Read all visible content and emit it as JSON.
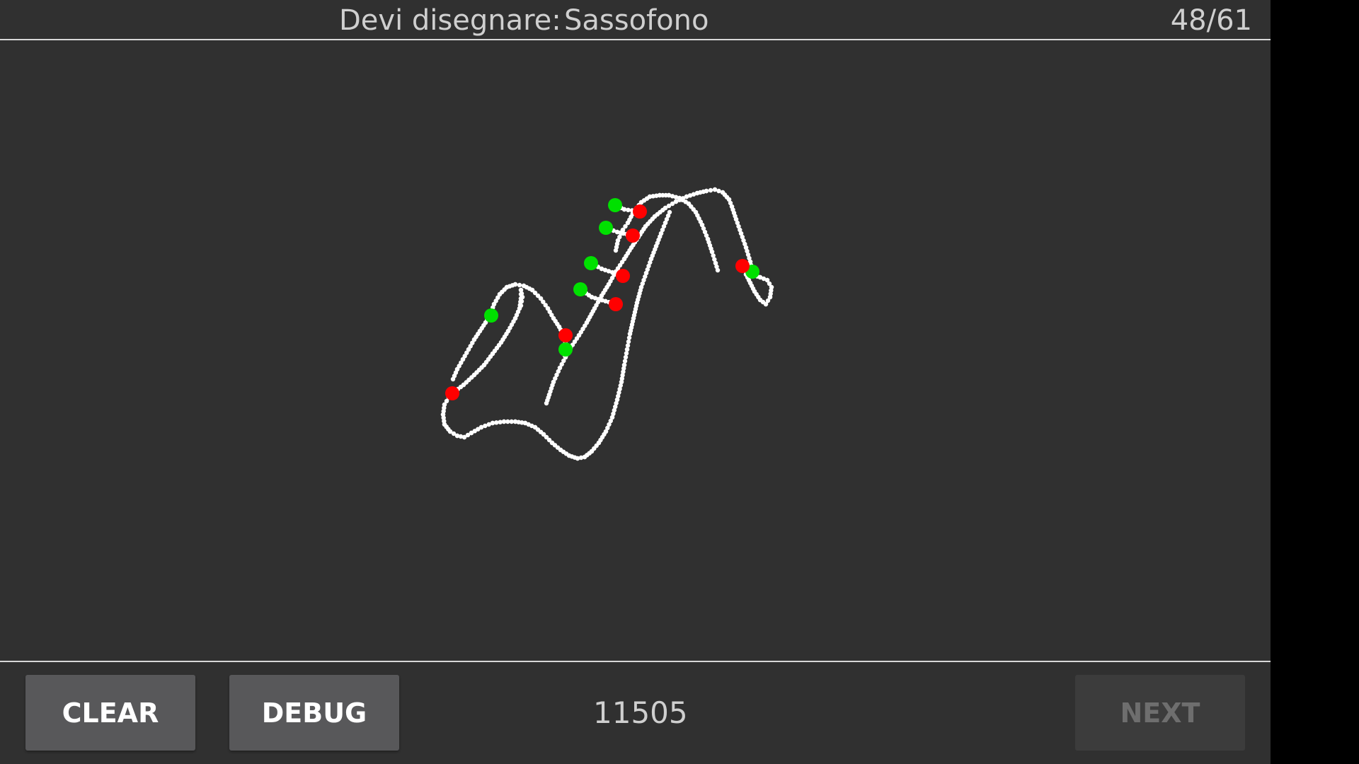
{
  "header": {
    "prompt_label": "Devi disegnare:",
    "prompt_word": "Sassofono",
    "progress": "48/61"
  },
  "footer": {
    "clear_label": "CLEAR",
    "debug_label": "DEBUG",
    "score": "11505",
    "next_label": "NEXT"
  },
  "colors": {
    "background": "#303030",
    "stroke": "#ffffff",
    "stroke_start": "#00e000",
    "stroke_end": "#ff0000"
  }
}
